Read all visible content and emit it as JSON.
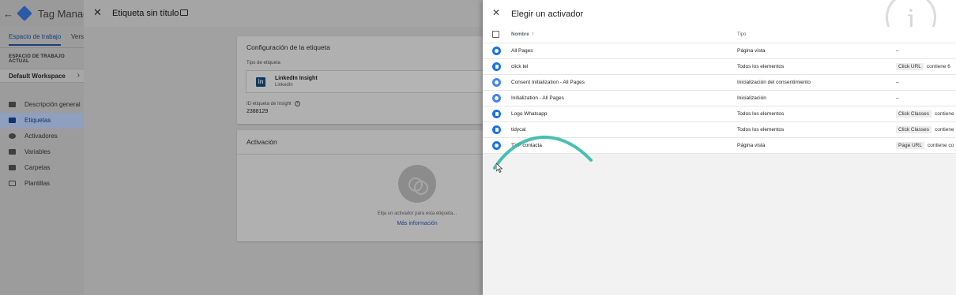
{
  "app": {
    "product_name": "Tag Manager",
    "back_glyph": "←"
  },
  "sidebar": {
    "tabs": [
      {
        "label": "Espacio de trabajo",
        "active": true
      },
      {
        "label": "Versiones",
        "active": false
      }
    ],
    "workspace_label": "ESPACIO DE TRABAJO ACTUAL",
    "workspace_name": "Default Workspace",
    "items": [
      {
        "label": "Descripción general",
        "icon": "briefcase-icon",
        "active": false
      },
      {
        "label": "Etiquetas",
        "icon": "tag-icon",
        "active": true
      },
      {
        "label": "Activadores",
        "icon": "trigger-icon",
        "active": false
      },
      {
        "label": "Variables",
        "icon": "variables-icon",
        "active": false
      },
      {
        "label": "Carpetas",
        "icon": "folder-icon",
        "active": false
      },
      {
        "label": "Plantillas",
        "icon": "template-icon",
        "active": false
      }
    ]
  },
  "editor": {
    "title": "Etiqueta sin título",
    "config_card": {
      "title": "Configuración de la etiqueta",
      "type_label": "Tipo de etiqueta",
      "tag_name": "LinkedIn Insight",
      "tag_vendor": "LinkedIn",
      "id_label": "ID etiqueta de Insight",
      "id_value": "2388129"
    },
    "trigger_card": {
      "title": "Activación",
      "hint": "Elija un activador para esta etiqueta...",
      "more_link": "Más información"
    }
  },
  "panel": {
    "title": "Elegir un activador",
    "columns": {
      "name": "Nombre",
      "type": "Tipo"
    },
    "sort_glyph": "↑",
    "rows": [
      {
        "name": "All Pages",
        "type": "Página vista",
        "icon": "eye-icon",
        "icon_color": "#1a73e8",
        "filter_var": "",
        "filter_op": "",
        "filter_plain": "–"
      },
      {
        "name": "click tel",
        "type": "Todos los elementos",
        "icon": "click-icon",
        "icon_color": "#1a73e8",
        "filter_var": "Click URL",
        "filter_op": "contiene 6",
        "filter_plain": ""
      },
      {
        "name": "Consent Initialization - All Pages",
        "type": "Inicialización del consentimiento",
        "icon": "consent-icon",
        "icon_color": "#4285f4",
        "filter_var": "",
        "filter_op": "",
        "filter_plain": "–"
      },
      {
        "name": "Initialization - All Pages",
        "type": "Inicialización",
        "icon": "power-icon",
        "icon_color": "#4285f4",
        "filter_var": "",
        "filter_op": "",
        "filter_plain": "–"
      },
      {
        "name": "Logo Whatsapp",
        "type": "Todos los elementos",
        "icon": "click-icon",
        "icon_color": "#1a73e8",
        "filter_var": "Click Classes",
        "filter_op": "contiene",
        "filter_plain": ""
      },
      {
        "name": "tidycal",
        "type": "Todos los elementos",
        "icon": "click-icon",
        "icon_color": "#1a73e8",
        "filter_var": "Click Classes",
        "filter_op": "contiene",
        "filter_plain": ""
      },
      {
        "name": "TYP contacta",
        "type": "Página vista",
        "icon": "eye-icon",
        "icon_color": "#1a73e8",
        "filter_var": "Page URL",
        "filter_op": "contiene co",
        "filter_plain": ""
      }
    ]
  },
  "colors": {
    "accent": "#1a73e8",
    "overlay_swoosh": "#2bb5a3"
  }
}
